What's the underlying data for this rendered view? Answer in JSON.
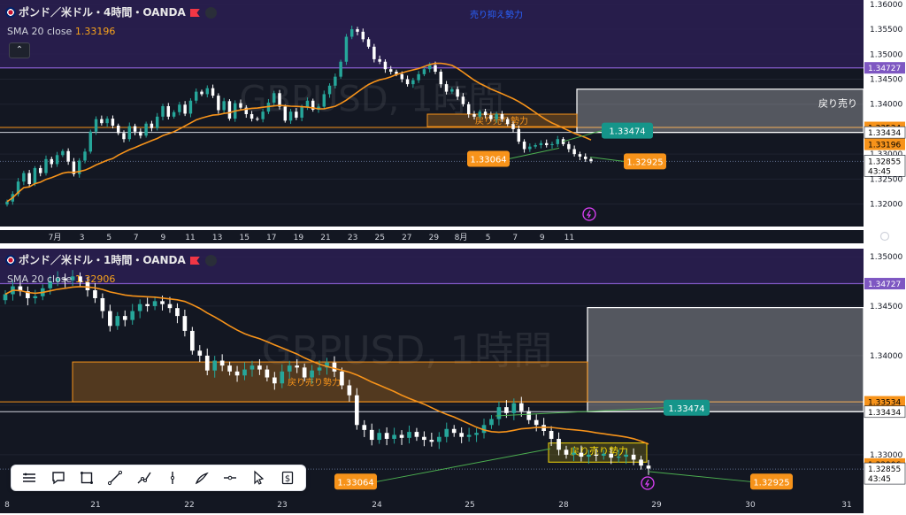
{
  "colors": {
    "background": "#131722",
    "grid": "#1f2330",
    "up": "#26a69a",
    "down": "#ffffff",
    "sma": "#f7931a",
    "resistance_line": "#7e57c2",
    "supply_zone_fill": "#2b1f52",
    "pullback_zone": "#f7931a",
    "white_box": "#b2b5be",
    "trendline": "#4caf50",
    "label_orange": "#f7931a",
    "label_teal": "#15958a",
    "label_purple": "#7e57c2"
  },
  "legend_common": {
    "flag_icon": "gb-us-flag-icon",
    "sma_label": "SMA 20 close"
  },
  "chart_data": [
    {
      "type": "candlestick",
      "title": "ポンド／米ドル・4時間・OANDA",
      "sma_value": "1.33196",
      "ylim": [
        1.3155,
        1.3605
      ],
      "y_ticks": [
        "1.36000",
        "1.35500",
        "1.35000",
        "1.34500",
        "1.34000",
        "1.33500",
        "1.33000",
        "1.32500",
        "1.32000"
      ],
      "x_ticks": [
        "7月",
        "3",
        "5",
        "7",
        "9",
        "11",
        "13",
        "15",
        "17",
        "19",
        "21",
        "23",
        "25",
        "27",
        "29",
        "8月",
        "5",
        "7",
        "9",
        "11"
      ],
      "watermark": "GBPUSD, 1時間",
      "zone_labels": {
        "resistance": "売り抑え勢力",
        "pullback": "戻り売り勢力",
        "box": "戻り売り"
      },
      "price_labels": [
        {
          "text": "1.33474",
          "value": 1.33474,
          "color": "#15958a"
        },
        {
          "text": "1.33064",
          "value": 1.33064,
          "color": "#f7931a"
        },
        {
          "text": "1.32925",
          "value": 1.32925,
          "color": "#f7931a"
        }
      ],
      "axis_labels": [
        {
          "text": "1.34727",
          "value": 1.34727,
          "bg": "#7e57c2",
          "fg": "#ffffff"
        },
        {
          "text": "1.33534",
          "value": 1.33534,
          "bg": "#f7931a",
          "fg": "#000000"
        },
        {
          "text": "1.33434",
          "value": 1.33434,
          "bg": "#ffffff",
          "fg": "#000000"
        },
        {
          "text": "1.33196",
          "value": 1.33196,
          "bg": "#f7931a",
          "fg": "#000000"
        },
        {
          "text": "1.32855",
          "value": 1.32855,
          "bg": "#ffffff",
          "fg": "#000000",
          "sub": "43:45"
        }
      ],
      "levels": {
        "resistance": 1.34727,
        "upper_line": 1.33534,
        "lower_line": 1.33434,
        "current": 1.32855
      },
      "close": [
        1.3205,
        1.322,
        1.3245,
        1.3262,
        1.324,
        1.3272,
        1.3262,
        1.329,
        1.328,
        1.3298,
        1.3306,
        1.3285,
        1.326,
        1.3287,
        1.3305,
        1.3345,
        1.337,
        1.3362,
        1.3371,
        1.3357,
        1.3342,
        1.333,
        1.3356,
        1.3345,
        1.3337,
        1.3361,
        1.3352,
        1.3375,
        1.3396,
        1.3375,
        1.3384,
        1.3399,
        1.3381,
        1.3407,
        1.3425,
        1.342,
        1.3432,
        1.3417,
        1.3388,
        1.3406,
        1.3371,
        1.3402,
        1.3393,
        1.338,
        1.3371,
        1.337,
        1.3385,
        1.3403,
        1.3422,
        1.3395,
        1.3367,
        1.3385,
        1.3373,
        1.3394,
        1.3407,
        1.3389,
        1.3395,
        1.342,
        1.3437,
        1.3455,
        1.3485,
        1.3535,
        1.355,
        1.3545,
        1.353,
        1.3515,
        1.349,
        1.3485,
        1.347,
        1.3465,
        1.346,
        1.345,
        1.344,
        1.3448,
        1.346,
        1.347,
        1.3478,
        1.3465,
        1.344,
        1.3425,
        1.343,
        1.3415,
        1.34,
        1.338,
        1.3375,
        1.3385,
        1.3378,
        1.337,
        1.338,
        1.337,
        1.336,
        1.335,
        1.3325,
        1.331,
        1.3315,
        1.3318,
        1.3322,
        1.3318,
        1.332,
        1.333,
        1.332,
        1.331,
        1.33,
        1.3295,
        1.329,
        1.3286
      ]
    },
    {
      "type": "candlestick",
      "title": "ポンド／米ドル・1時間・OANDA",
      "sma_value": "1.32906",
      "ylim": [
        1.3257,
        1.3508
      ],
      "y_ticks": [
        "1.35000",
        "1.34500",
        "1.34000",
        "1.33500",
        "1.33000"
      ],
      "x_ticks": [
        "8",
        "21",
        "22",
        "23",
        "24",
        "25",
        "28",
        "29",
        "30",
        "31"
      ],
      "watermark": "GBPUSD, 1時間",
      "zone_labels": {
        "pullback": "戻り売り勢力"
      },
      "price_labels": [
        {
          "text": "1.33474",
          "value": 1.33474,
          "color": "#15958a"
        },
        {
          "text": "1.33064",
          "value": 1.33064,
          "color": "#f7931a"
        },
        {
          "text": "1.32925",
          "value": 1.32925,
          "color": "#f7931a"
        }
      ],
      "axis_labels": [
        {
          "text": "1.34727",
          "value": 1.34727,
          "bg": "#7e57c2",
          "fg": "#ffffff"
        },
        {
          "text": "1.33534",
          "value": 1.33534,
          "bg": "#f7931a",
          "fg": "#000000"
        },
        {
          "text": "1.33434",
          "value": 1.33434,
          "bg": "#ffffff",
          "fg": "#000000"
        },
        {
          "text": "1.32906",
          "value": 1.32906,
          "bg": "#f7931a",
          "fg": "#000000"
        },
        {
          "text": "1.32855",
          "value": 1.32855,
          "bg": "#ffffff",
          "fg": "#000000",
          "sub": "43:45"
        }
      ],
      "levels": {
        "resistance": 1.34727,
        "upper_line": 1.33534,
        "lower_line": 1.33434,
        "current": 1.32855
      },
      "close": [
        1.3462,
        1.347,
        1.3465,
        1.3458,
        1.346,
        1.3468,
        1.3475,
        1.3478,
        1.3476,
        1.348,
        1.3474,
        1.3466,
        1.3458,
        1.3445,
        1.343,
        1.344,
        1.3436,
        1.3445,
        1.3452,
        1.345,
        1.3455,
        1.3452,
        1.3448,
        1.344,
        1.3425,
        1.3405,
        1.34,
        1.3385,
        1.3395,
        1.339,
        1.3384,
        1.338,
        1.3386,
        1.339,
        1.3386,
        1.3378,
        1.3372,
        1.3384,
        1.339,
        1.3388,
        1.3378,
        1.3385,
        1.3388,
        1.3393,
        1.3384,
        1.337,
        1.336,
        1.333,
        1.3325,
        1.3315,
        1.3322,
        1.3316,
        1.332,
        1.3317,
        1.3323,
        1.3318,
        1.3315,
        1.3313,
        1.3318,
        1.3326,
        1.3322,
        1.3318,
        1.332,
        1.3322,
        1.333,
        1.3336,
        1.3348,
        1.3342,
        1.3352,
        1.3344,
        1.3335,
        1.333,
        1.3324,
        1.3316,
        1.3305,
        1.33,
        1.3302,
        1.3298,
        1.33,
        1.3299,
        1.3301,
        1.3297,
        1.3298,
        1.33,
        1.3295,
        1.3289,
        1.3286
      ]
    }
  ],
  "toolbar": [
    {
      "icon": "layers-icon"
    },
    {
      "icon": "comment-icon"
    },
    {
      "icon": "rectangle-icon"
    },
    {
      "icon": "trend-line-icon"
    },
    {
      "icon": "path-icon"
    },
    {
      "icon": "vertical-line-icon"
    },
    {
      "icon": "brush-icon"
    },
    {
      "icon": "horizontal-ray-icon"
    },
    {
      "icon": "cursor-icon"
    },
    {
      "icon": "price-tag-icon"
    }
  ]
}
